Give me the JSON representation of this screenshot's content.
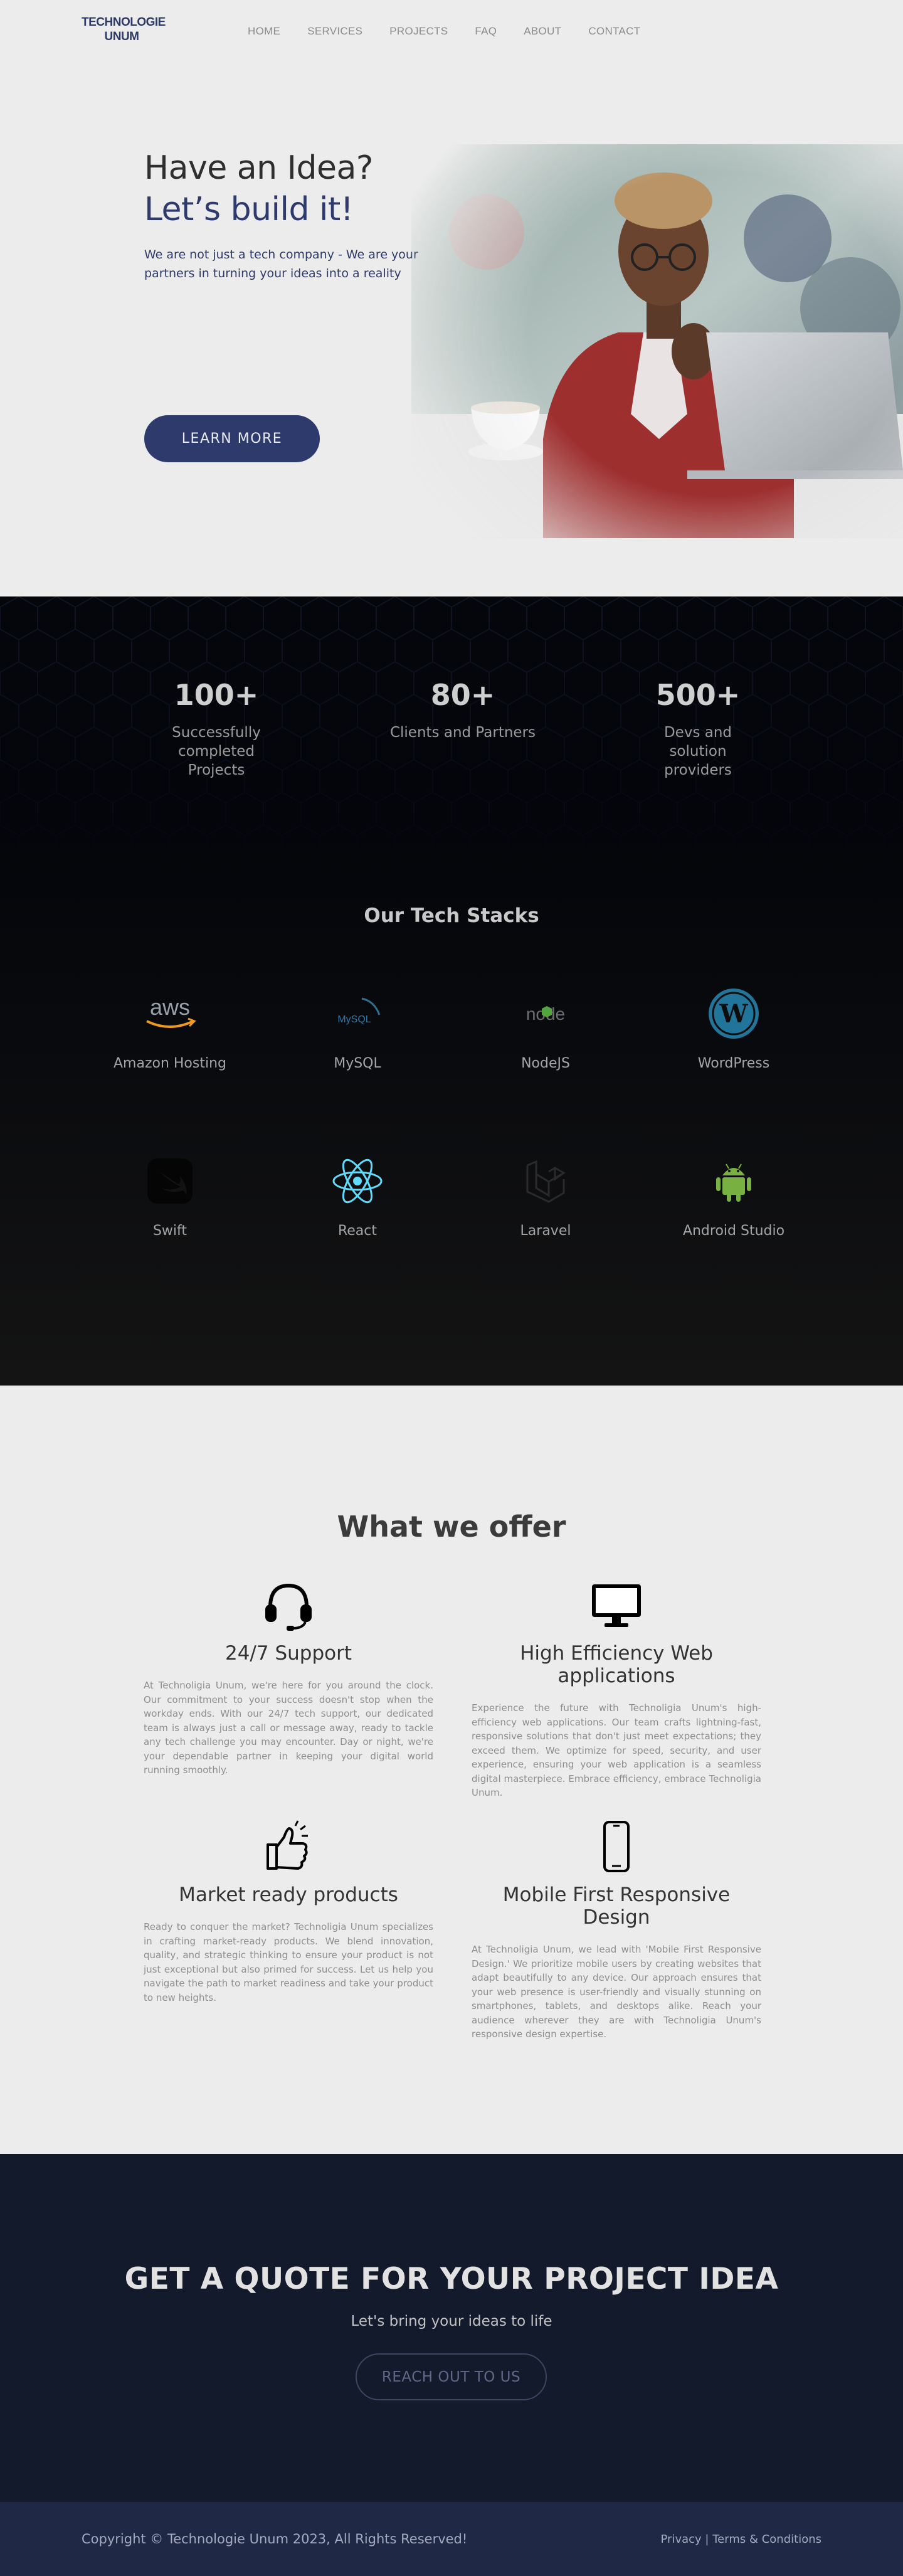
{
  "nav": {
    "logo_line1": "TECHNOLOGIE",
    "logo_line2": "UNUM",
    "links": [
      "HOME",
      "SERVICES",
      "PROJECTS",
      "FAQ",
      "ABOUT",
      "CONTACT"
    ]
  },
  "hero": {
    "line1": "Have an Idea?",
    "line2": "Let’s build it!",
    "description": "We are not just a tech company - We are your partners in turning your ideas into a reality",
    "cta": "LEARN MORE"
  },
  "stats": [
    {
      "value": "100+",
      "label": "Successfully completed Projects"
    },
    {
      "value": "80+",
      "label": "Clients and Partners"
    },
    {
      "value": "500+",
      "label": "Devs and solution providers"
    }
  ],
  "tech_stack": {
    "title": "Our Tech Stacks",
    "items": [
      {
        "label": "Amazon Hosting",
        "icon": "aws-icon",
        "icon_text": "aws"
      },
      {
        "label": "MySQL",
        "icon": "mysql-icon",
        "icon_text": "MySQL"
      },
      {
        "label": "NodeJS",
        "icon": "nodejs-icon",
        "icon_text": "node"
      },
      {
        "label": "WordPress",
        "icon": "wordpress-icon",
        "icon_text": "W"
      },
      {
        "label": "Swift",
        "icon": "swift-icon"
      },
      {
        "label": "React",
        "icon": "react-icon"
      },
      {
        "label": "Laravel",
        "icon": "laravel-icon"
      },
      {
        "label": "Android Studio",
        "icon": "android-icon"
      }
    ]
  },
  "offer": {
    "title": "What we offer",
    "cards": [
      {
        "title": "24/7 Support",
        "icon": "headset-icon",
        "text": "At Technoligia Unum, we're here for you around the clock. Our commitment to your success doesn't stop when the workday ends. With our 24/7 tech support, our dedicated team is always just a call or message away, ready to tackle any tech challenge you may encounter. Day or night, we're your dependable partner in keeping your digital world running smoothly."
      },
      {
        "title": "High Efficiency Web applications",
        "icon": "monitor-icon",
        "text": "Experience the future with Technoligia Unum's high-efficiency web applications. Our team crafts lightning-fast, responsive solutions that don't just meet expectations; they exceed them. We optimize for speed, security, and user experience, ensuring your web application is a seamless digital masterpiece. Embrace efficiency, embrace Technoligia Unum."
      },
      {
        "title": "Market ready products",
        "icon": "thumbs-up-icon",
        "text": "Ready to conquer the market? Technoligia Unum specializes in crafting market-ready products. We blend innovation, quality, and strategic thinking to ensure your product is not just exceptional but also primed for success. Let us help you navigate the path to market readiness and take your product to new heights."
      },
      {
        "title": "Mobile First Responsive Design",
        "icon": "smartphone-icon",
        "text": "At Technoligia Unum, we lead with 'Mobile First Responsive Design.' We prioritize mobile users by creating websites that adapt beautifully to any device. Our approach ensures that your web presence is user-friendly and visually stunning on smartphones, tablets, and desktops alike. Reach your audience wherever they are with Technoligia Unum's responsive design expertise."
      }
    ]
  },
  "quote": {
    "title": "GET A QUOTE FOR YOUR PROJECT IDEA",
    "subtitle": "Let's bring your ideas to life",
    "cta": "REACH OUT TO US"
  },
  "footer": {
    "copyright": "Copyright © Technologie Unum 2023, All Rights Reserved!",
    "privacy": "Privacy",
    "separator": "|",
    "terms": "Terms & Conditions"
  },
  "colors": {
    "brand_navy": "#2e3a6b",
    "quote_bg": "#131a2b",
    "footer_bg": "#1f2844"
  }
}
